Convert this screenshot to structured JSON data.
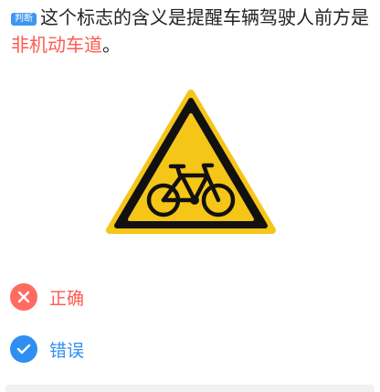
{
  "question": {
    "tag": "判断",
    "text_before": "这个标志的含义是提醒车辆驾驶人前方是",
    "highlight": "非机动车道",
    "text_after": "。"
  },
  "sign": {
    "icon": "non-motor-vehicle-lane-warning-sign",
    "fill_color": "#f5c518",
    "border_color": "#111111"
  },
  "options": [
    {
      "label": "正确",
      "state": "wrong",
      "icon": "close-icon",
      "color": "#ff6b60"
    },
    {
      "label": "错误",
      "state": "correct",
      "icon": "check-icon",
      "color": "#2f8ef2"
    }
  ]
}
